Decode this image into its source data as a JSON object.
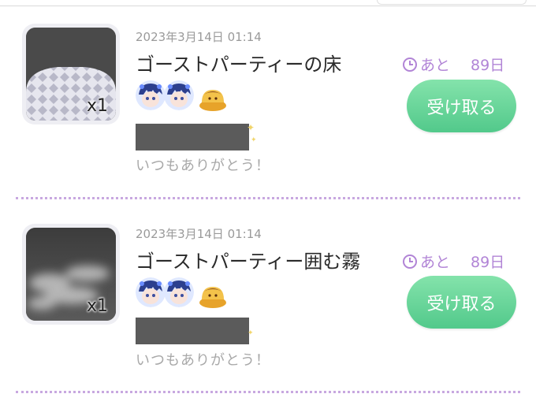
{
  "gifts": [
    {
      "date": "2023年3月14日 01:14",
      "name": "ゴーストパーティーの床",
      "quantity": "x1",
      "expire_prefix": "あと",
      "expire_days": "89日",
      "button_label": "受け取る",
      "message": "いつもありがとう！"
    },
    {
      "date": "2023年3月14日 01:14",
      "name": "ゴーストパーティー囲む霧",
      "quantity": "x1",
      "expire_prefix": "あと",
      "expire_days": "89日",
      "button_label": "受け取る",
      "message": "いつもありがとう！"
    }
  ],
  "colors": {
    "accent_purple": "#b184d6",
    "button_green": "#5cce92",
    "divider_dots": "#c8a8e0"
  }
}
